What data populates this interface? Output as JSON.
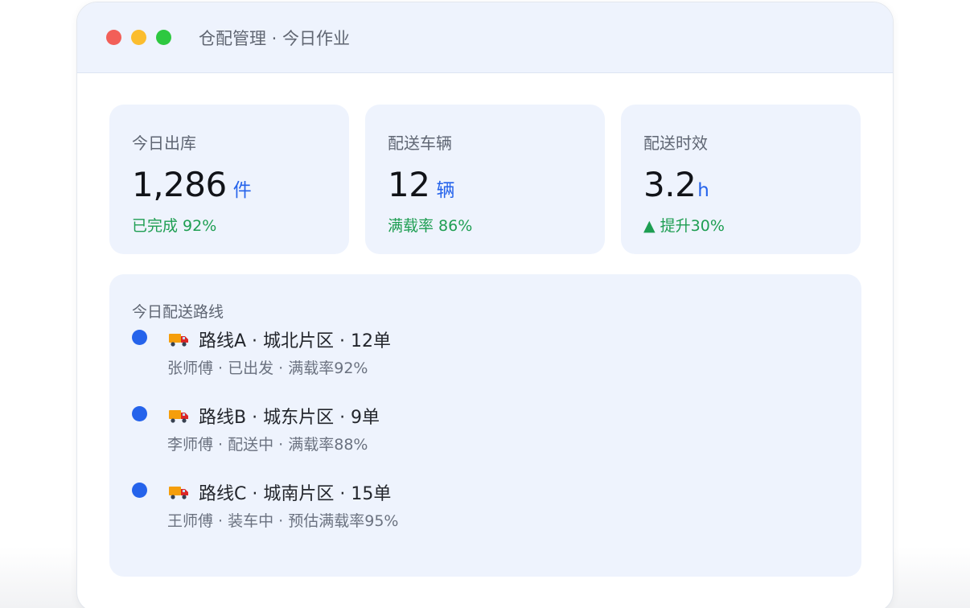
{
  "window": {
    "title": "仓配管理 · 今日作业"
  },
  "stats": [
    {
      "label": "今日出库",
      "value": "1,286",
      "unit": "件",
      "sub": "已完成 92%"
    },
    {
      "label": "配送车辆",
      "value": "12",
      "unit": "辆",
      "sub": "满载率 86%"
    },
    {
      "label": "配送时效",
      "value": "3.2",
      "unit": "h",
      "sub": "▲ 提升30%"
    }
  ],
  "routes": {
    "title": "今日配送路线",
    "items": [
      {
        "icon": "truck-icon",
        "name": "路线A · 城北片区 · 12单",
        "detail": "张师傅 · 已出发 · 满载率92%"
      },
      {
        "icon": "truck-icon",
        "name": "路线B · 城东片区 · 9单",
        "detail": "李师傅 · 配送中 · 满载率88%"
      },
      {
        "icon": "truck-icon",
        "name": "路线C · 城南片区 · 15单",
        "detail": "王师傅 · 装车中 · 预估满载率95%"
      }
    ]
  },
  "colors": {
    "accent": "#2563eb",
    "positive": "#1e9e52",
    "card_bg": "#eef3fd",
    "close": "#f25f58",
    "minimize": "#fbbd2e",
    "maximize": "#2ec840"
  }
}
